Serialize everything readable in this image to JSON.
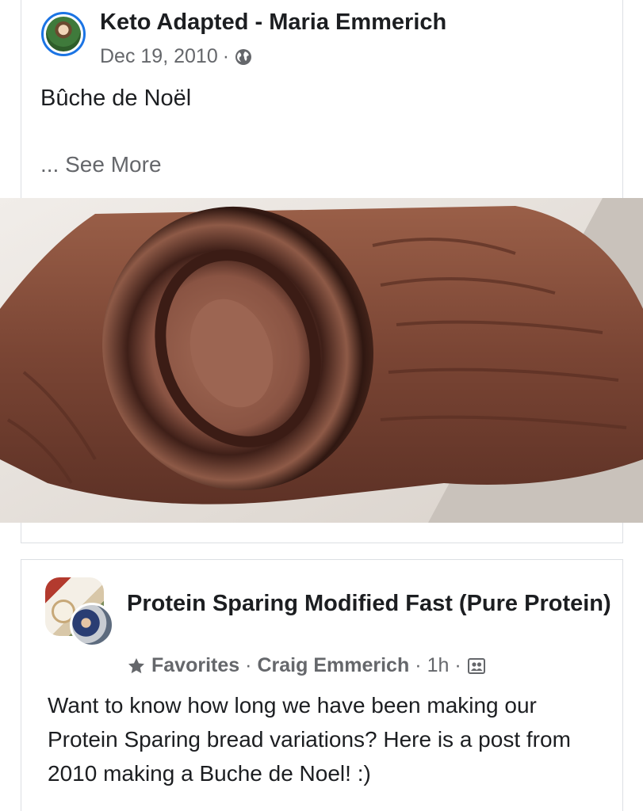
{
  "post1": {
    "author": "Keto Adapted - Maria Emmerich",
    "date": "Dec 19, 2010",
    "separator": "·",
    "privacy_icon": "globe-icon",
    "title": "Bûche de Noël",
    "see_more": "... See More",
    "photo_icon": "chocolate-yule-log-photo"
  },
  "post2": {
    "group_name": "Protein Sparing Modified Fast (Pure Protein)",
    "badge_icon": "star-icon",
    "badge_label": "Favorites",
    "sep1": "·",
    "poster": "Craig Emmerich",
    "sep2": "·",
    "time": "1h",
    "sep3": "·",
    "audience_icon": "group-members-icon",
    "body": "Want to know how long we have been making our Protein Sparing bread variations? Here is a post from 2010 making a Buche de Noel! :)"
  },
  "colors": {
    "accent": "#1b74e4",
    "text_primary": "#1c1e21",
    "text_secondary": "#65676b",
    "divider": "#dcdfe3"
  }
}
